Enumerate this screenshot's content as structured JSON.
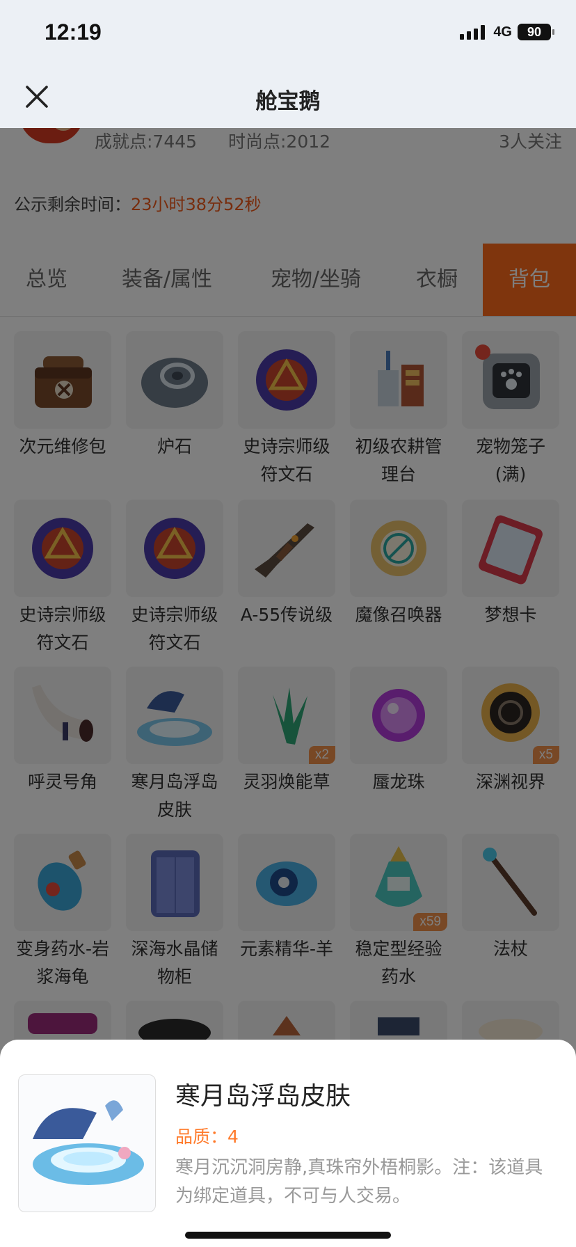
{
  "status_bar": {
    "time": "12:19",
    "network": "4G",
    "battery": "90"
  },
  "nav": {
    "title": "舱宝鹅",
    "close_icon": "close-icon"
  },
  "profile": {
    "achievement": "成就点:7445",
    "fashion": "时尚点:2012",
    "followers": "3人关注"
  },
  "announcement": {
    "label": "公示剩余时间：",
    "time": "23小时38分52秒"
  },
  "tabs": [
    {
      "label": "总览",
      "active": false
    },
    {
      "label": "装备/属性",
      "active": false
    },
    {
      "label": "宠物/坐骑",
      "active": false
    },
    {
      "label": "衣橱",
      "active": false
    },
    {
      "label": "背包",
      "active": true
    }
  ],
  "items": [
    {
      "name": "次元维修包",
      "icon": "repair-bag-icon"
    },
    {
      "name": "炉石",
      "icon": "hearthstone-icon"
    },
    {
      "name": "史诗宗师级符文石",
      "icon": "rune-stone-icon"
    },
    {
      "name": "初级农耕管理台",
      "icon": "farm-console-icon"
    },
    {
      "name": "宠物笼子(满)",
      "icon": "pet-cage-icon"
    },
    {
      "name": "史诗宗师级符文石",
      "icon": "rune-stone-icon"
    },
    {
      "name": "史诗宗师级符文石",
      "icon": "rune-stone-icon"
    },
    {
      "name": "A-55传说级",
      "icon": "rifle-icon"
    },
    {
      "name": "魔像召唤器",
      "icon": "golem-summoner-icon"
    },
    {
      "name": "梦想卡",
      "icon": "dream-card-icon"
    },
    {
      "name": "呼灵号角",
      "icon": "horn-icon"
    },
    {
      "name": "寒月岛浮岛皮肤",
      "icon": "floating-island-icon"
    },
    {
      "name": "灵羽焕能草",
      "icon": "herb-icon",
      "count": "x2"
    },
    {
      "name": "蜃龙珠",
      "icon": "orb-icon"
    },
    {
      "name": "深渊视界",
      "icon": "abyss-eye-icon",
      "count": "x5"
    },
    {
      "name": "变身药水-岩浆海龟",
      "icon": "potion-bottle-icon"
    },
    {
      "name": "深海水晶储物柜",
      "icon": "wardrobe-icon"
    },
    {
      "name": "元素精华-羊",
      "icon": "element-essence-icon"
    },
    {
      "name": "稳定型经验药水",
      "icon": "exp-potion-icon",
      "count": "x59"
    },
    {
      "name": "法杖",
      "icon": "staff-icon"
    },
    {
      "name": "",
      "icon": "partial-item-icon"
    },
    {
      "name": "",
      "icon": "partial-item-icon"
    },
    {
      "name": "",
      "icon": "partial-item-icon"
    },
    {
      "name": "",
      "icon": "partial-item-icon"
    },
    {
      "name": "",
      "icon": "partial-item-icon"
    }
  ],
  "item_sheet": {
    "title": "寒月岛浮岛皮肤",
    "quality": "品质：4",
    "description": "寒月沉沉洞房静,真珠帘外梧桐影。注：该道具为绑定道具，不可与人交易。",
    "icon": "floating-island-icon"
  },
  "colors": {
    "accent": "#ff6a1a",
    "quality": "#ff7a2a",
    "timer": "#f05a1a"
  }
}
